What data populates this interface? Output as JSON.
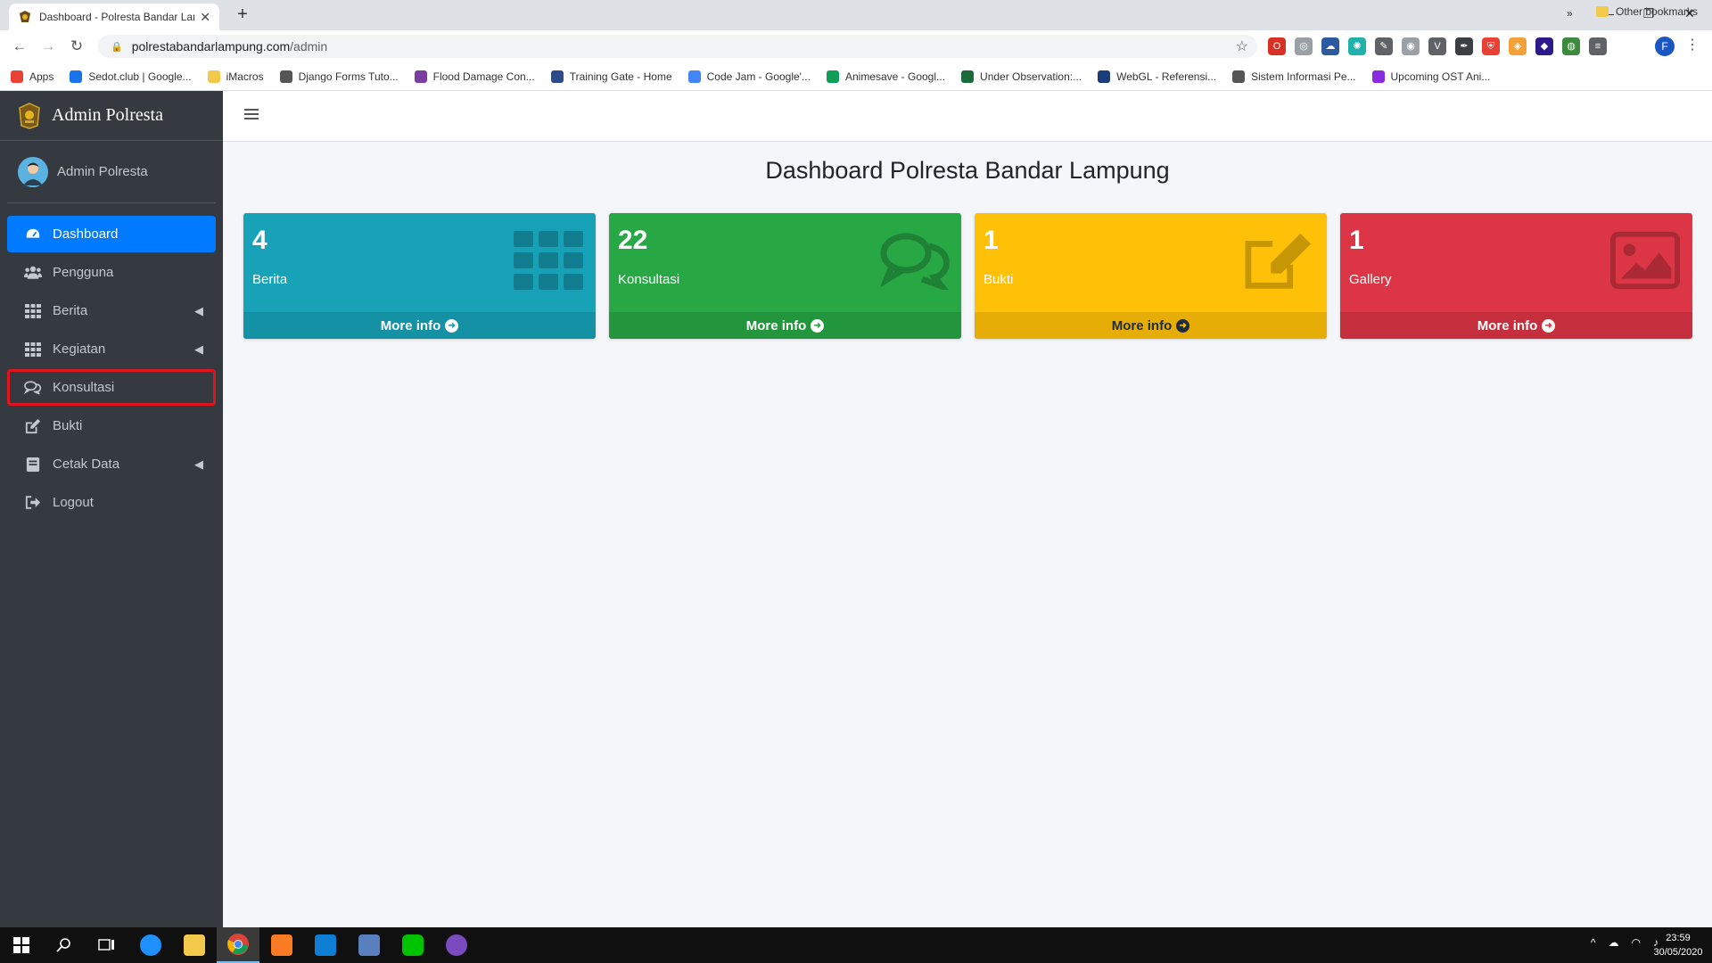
{
  "browser": {
    "tab_title": "Dashboard - Polresta Bandar Lampung",
    "url_domain": "polrestabandarlampung.com",
    "url_path": "/admin",
    "profile_letter": "F",
    "bookmarks": [
      {
        "label": "Apps",
        "color": "#e94235"
      },
      {
        "label": "Sedot.club | Google...",
        "color": "#1a73e8"
      },
      {
        "label": "iMacros",
        "color": "#f3c94c"
      },
      {
        "label": "Django Forms Tuto...",
        "color": "#555555"
      },
      {
        "label": "Flood Damage Con...",
        "color": "#7b3fa0"
      },
      {
        "label": "Training Gate - Home",
        "color": "#2d4a8a"
      },
      {
        "label": "Code Jam - Google'...",
        "color": "#4285f4"
      },
      {
        "label": "Animesave - Googl...",
        "color": "#0f9d58"
      },
      {
        "label": "Under Observation:...",
        "color": "#1b6b3a"
      },
      {
        "label": "WebGL - Referensi...",
        "color": "#1b3d7a"
      },
      {
        "label": "Sistem Informasi Pe...",
        "color": "#555555"
      },
      {
        "label": "Upcoming OST Ani...",
        "color": "#8a2be2"
      }
    ],
    "bookmarks_more": "»",
    "other_bookmarks": "Other bookmarks"
  },
  "sidebar": {
    "brand": "Admin Polresta",
    "user_name": "Admin Polresta",
    "items": [
      {
        "label": "Dashboard",
        "icon": "tachometer-icon",
        "active": true,
        "caret": false
      },
      {
        "label": "Pengguna",
        "icon": "users-icon",
        "active": false,
        "caret": false
      },
      {
        "label": "Berita",
        "icon": "th-grid-icon",
        "active": false,
        "caret": true
      },
      {
        "label": "Kegiatan",
        "icon": "th-grid-icon",
        "active": false,
        "caret": true
      },
      {
        "label": "Konsultasi",
        "icon": "comments-icon",
        "active": false,
        "caret": false
      },
      {
        "label": "Bukti",
        "icon": "edit-icon",
        "active": false,
        "caret": false
      },
      {
        "label": "Cetak Data",
        "icon": "book-icon",
        "active": false,
        "caret": true
      },
      {
        "label": "Logout",
        "icon": "sign-out-icon",
        "active": false,
        "caret": false
      }
    ]
  },
  "main": {
    "title": "Dashboard Polresta Bandar Lampung",
    "cards": [
      {
        "count": "4",
        "label": "Berita",
        "more": "More info",
        "color": "#17a2b8",
        "icon": "th-grid-icon"
      },
      {
        "count": "22",
        "label": "Konsultasi",
        "more": "More info",
        "color": "#28a745",
        "icon": "comments-icon"
      },
      {
        "count": "1",
        "label": "Bukti",
        "more": "More info",
        "color": "#ffc107",
        "icon": "edit-icon"
      },
      {
        "count": "1",
        "label": "Gallery",
        "more": "More info",
        "color": "#dc3545",
        "icon": "image-icon"
      }
    ]
  },
  "taskbar": {
    "time": "23:59",
    "date": "30/05/2020"
  }
}
